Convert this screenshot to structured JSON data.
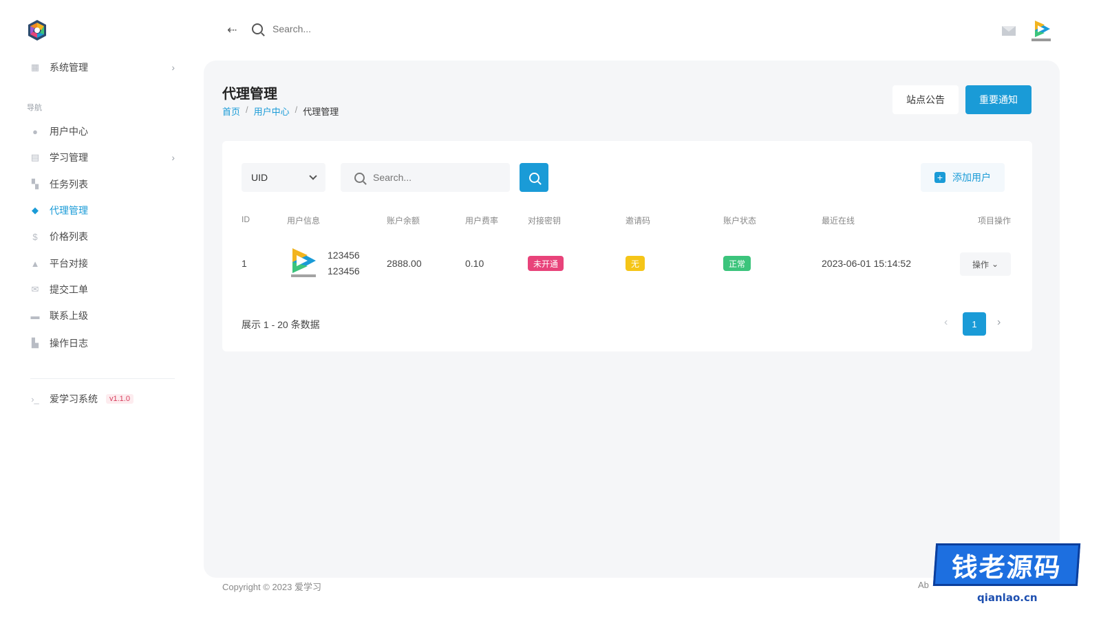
{
  "topbar": {
    "search_placeholder": "Search..."
  },
  "sidebar": {
    "system_item": "系统管理",
    "nav_label": "导航",
    "items": [
      {
        "label": "用户中心",
        "icon": "user-icon"
      },
      {
        "label": "学习管理",
        "icon": "cart-icon"
      },
      {
        "label": "任务列表",
        "icon": "task-icon"
      },
      {
        "label": "代理管理",
        "icon": "agent-icon",
        "active": true
      },
      {
        "label": "价格列表",
        "icon": "dollar-icon"
      },
      {
        "label": "平台对接",
        "icon": "platform-icon"
      },
      {
        "label": "提交工单",
        "icon": "mail-icon"
      },
      {
        "label": "联系上级",
        "icon": "chat-icon"
      },
      {
        "label": "操作日志",
        "icon": "log-icon"
      }
    ],
    "app_name": "爱学习系统",
    "version": "v1.1.0"
  },
  "page": {
    "title": "代理管理",
    "breadcrumb": [
      "首页",
      "/",
      "用户中心",
      "/",
      "代理管理"
    ],
    "btn_notice": "站点公告",
    "btn_important": "重要通知"
  },
  "filter": {
    "select_value": "UID",
    "search_placeholder": "Search...",
    "add_user": "添加用户"
  },
  "table": {
    "headers": [
      "ID",
      "用户信息",
      "账户余额",
      "用户费率",
      "对接密钥",
      "邀请码",
      "账户状态",
      "最近在线",
      "项目操作"
    ],
    "rows": [
      {
        "id": "1",
        "user_line1": "123456",
        "user_line2": "123456",
        "balance": "2888.00",
        "rate": "0.10",
        "key_status": "未开通",
        "invite": "无",
        "status": "正常",
        "last_online": "2023-06-01 15:14:52",
        "op": "操作"
      }
    ]
  },
  "pager": {
    "info": "展示 1 - 20 条数据",
    "page": "1"
  },
  "footer": {
    "copyright": "Copyright © 2023 爱学习",
    "about": "Ab"
  },
  "watermark": {
    "main": "钱老源码",
    "sub": "qianlao.cn"
  },
  "colors": {
    "accent": "#1a9bd7",
    "badge_red": "#e8437a",
    "badge_yellow": "#f5c518",
    "badge_green": "#3cc47c"
  }
}
